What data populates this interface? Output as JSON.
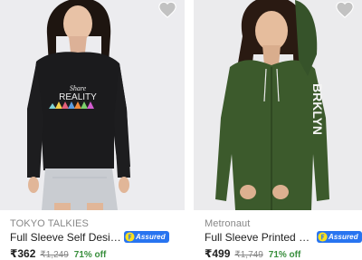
{
  "products": [
    {
      "brand": "TOKYO TALKIES",
      "title": "Full Sleeve Self Design Women Sweatshirt",
      "assured_label": "Assured",
      "price": "₹362",
      "mrp": "₹1,249",
      "discount": "71% off",
      "print_text_1": "Share",
      "print_text_2": "REALITY"
    },
    {
      "brand": "Metronaut",
      "title": "Full Sleeve Printed Women Sweatshirt",
      "assured_label": "Assured",
      "price": "₹499",
      "mrp": "₹1,749",
      "discount": "71% off",
      "print_text_1": "BRKLYN"
    }
  ],
  "colors": {
    "assured_blue": "#2874f0",
    "discount_green": "#388e3c",
    "sweater_black": "#1b1b1d",
    "hoodie_green": "#3c5a2c"
  },
  "icons": {
    "wishlist": "heart-icon",
    "assured": "flipkart-f-icon"
  }
}
